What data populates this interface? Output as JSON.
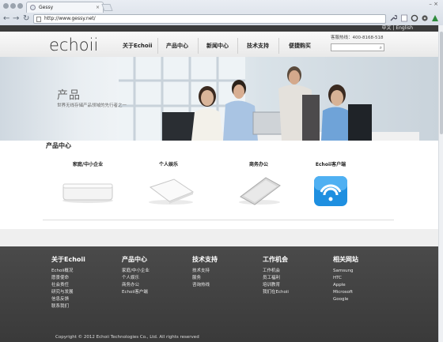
{
  "browser": {
    "tab_title": "Gessy",
    "url": "http://www.gessy.net/",
    "win_controls": "– ×"
  },
  "site": {
    "lang": {
      "zh": "中文",
      "sep": "|",
      "en": "English"
    },
    "logo": "echoii",
    "nav": [
      "关于Echoii",
      "产品中心",
      "新闻中心",
      "技术支持",
      "便捷购买"
    ],
    "hotline": "客服热线：400-8168-518",
    "banner": {
      "title": "产品",
      "subtitle": "世界无线存储产品领域的先行者之一"
    },
    "products": {
      "title": "产品中心",
      "items": [
        "家庭/中小企业",
        "个人娱乐",
        "商务办公",
        "Echoii客户端"
      ]
    },
    "footer": {
      "columns": [
        {
          "title": "关于Echoii",
          "links": [
            "Echoii概况",
            "愿景使命",
            "社会责任",
            "研究与发展",
            "信息反馈",
            "联系我们"
          ]
        },
        {
          "title": "产品中心",
          "links": [
            "家庭/中小企业",
            "个人娱乐",
            "商务办公",
            "Echoii客户端"
          ]
        },
        {
          "title": "技术支持",
          "links": [
            "技术支持",
            "服务",
            "咨询热线"
          ]
        },
        {
          "title": "工作机会",
          "links": [
            "工作机会",
            "员工福利",
            "培训教育",
            "我们在Echoii"
          ]
        },
        {
          "title": "相关网站",
          "links": [
            "Samsung",
            "HTC",
            "Apple",
            "Microsoft",
            "Google"
          ]
        }
      ],
      "copyright": "Copyright © 2012 Echoii Technologies Co., Ltd. All rights reserved"
    }
  },
  "colors": {
    "footer_bg": "#3f3f3f",
    "top_strip": "#3b3b3b",
    "wifi_blue": "#1e8fe0"
  }
}
